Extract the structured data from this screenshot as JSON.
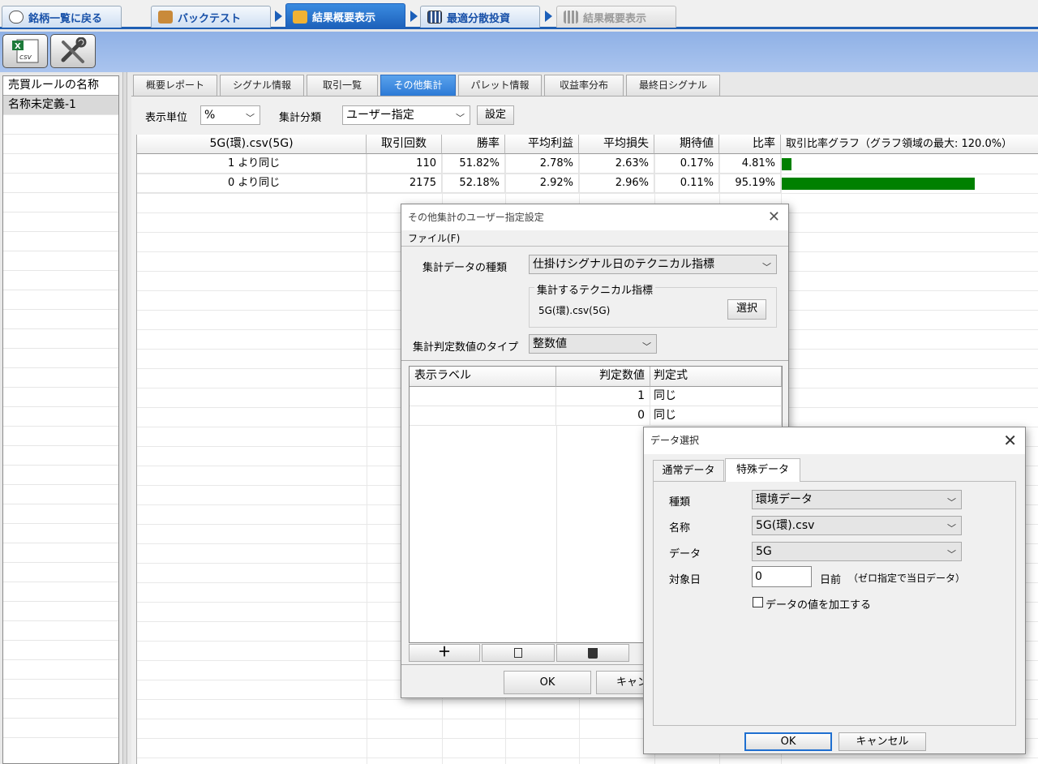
{
  "nav": {
    "back": "銘柄一覧に戻る",
    "backtest": "バックテスト",
    "summary": "結果概要表示",
    "optimal": "最適分散投資",
    "summary2": "結果概要表示"
  },
  "left": {
    "header": "売買ルールの名称",
    "item": "名称未定義-1"
  },
  "tabs": [
    "概要レポート",
    "シグナル情報",
    "取引一覧",
    "その他集計",
    "パレット情報",
    "収益率分布",
    "最終日シグナル"
  ],
  "controls": {
    "unit_label": "表示単位",
    "unit_value": "%",
    "class_label": "集計分類",
    "class_value": "ユーザー指定",
    "set_button": "設定"
  },
  "table": {
    "headers": [
      "5G(環).csv(5G)",
      "取引回数",
      "勝率",
      "平均利益",
      "平均損失",
      "期待値",
      "比率",
      "取引比率グラフ（グラフ領域の最大: 120.0%）"
    ],
    "rows": [
      {
        "label": "1 より同じ",
        "count": "110",
        "win": "51.82%",
        "avg_profit": "2.78%",
        "avg_loss": "2.63%",
        "expect": "0.17%",
        "ratio": "4.81%",
        "ratio_value": 4.81
      },
      {
        "label": "0 より同じ",
        "count": "2175",
        "win": "52.18%",
        "avg_profit": "2.92%",
        "avg_loss": "2.96%",
        "expect": "0.11%",
        "ratio": "95.19%",
        "ratio_value": 95.19
      }
    ],
    "graph_max": 120.0,
    "bar_color": "#008000"
  },
  "dlg1": {
    "title": "その他集計のユーザー指定設定",
    "menu": "ファイル(F)",
    "data_type_label": "集計データの種類",
    "data_type_value": "仕掛けシグナル日のテクニカル指標",
    "group_title": "集計するテクニカル指標",
    "indicator": "5G(環).csv(5G)",
    "select_button": "選択",
    "num_type_label": "集計判定数値のタイプ",
    "num_type_value": "整数値",
    "grid_headers": [
      "表示ラベル",
      "判定数値",
      "判定式"
    ],
    "rows": [
      {
        "label": "",
        "value": "1",
        "expr": "同じ"
      },
      {
        "label": "",
        "value": "0",
        "expr": "同じ"
      }
    ],
    "ok": "OK",
    "cancel": "キャン"
  },
  "dlg2": {
    "title": "データ選択",
    "tab_normal": "通常データ",
    "tab_special": "特殊データ",
    "kind_label": "種類",
    "kind_value": "環境データ",
    "name_label": "名称",
    "name_value": "5G(環).csv",
    "data_label": "データ",
    "data_value": "5G",
    "day_label": "対象日",
    "day_value": "0",
    "day_unit": "日前",
    "day_note": "（ゼロ指定で当日データ）",
    "check_label": "データの値を加工する",
    "ok": "OK",
    "cancel": "キャンセル"
  }
}
